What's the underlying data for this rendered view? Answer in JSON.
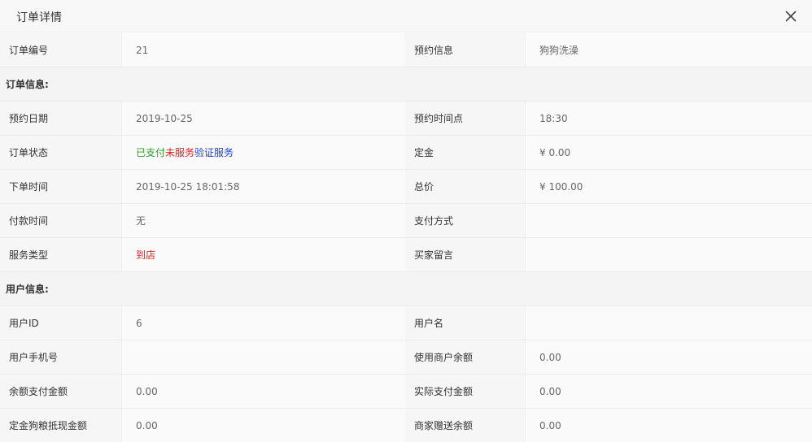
{
  "dialog": {
    "title": "订单详情"
  },
  "top_row": {
    "order_no_label": "订单编号",
    "order_no_value": "21",
    "booking_info_label": "预约信息",
    "booking_info_value": "狗狗洗澡"
  },
  "order_section": {
    "heading": "订单信息:",
    "booking_date_label": "预约日期",
    "booking_date_value": "2019-10-25",
    "booking_time_label": "预约时间点",
    "booking_time_value": "18:30",
    "status_label": "订单状态",
    "status_paid": "已支付",
    "status_unserved": "未服务",
    "status_verify": "验证服务",
    "deposit_label": "定金",
    "deposit_value": "¥ 0.00",
    "order_time_label": "下单时间",
    "order_time_value": "2019-10-25 18:01:58",
    "total_label": "总价",
    "total_value": "¥ 100.00",
    "pay_time_label": "付款时间",
    "pay_time_value": "无",
    "pay_method_label": "支付方式",
    "pay_method_value": "",
    "service_type_label": "服务类型",
    "service_type_value": "到店",
    "buyer_note_label": "买家留言",
    "buyer_note_value": ""
  },
  "user_section": {
    "heading": "用户信息:",
    "user_id_label": "用户ID",
    "user_id_value": "6",
    "username_label": "用户名",
    "username_value": "",
    "phone_label": "用户手机号",
    "phone_value": "",
    "merchant_balance_label": "使用商户余额",
    "merchant_balance_value": "0.00",
    "balance_pay_label": "余额支付金额",
    "balance_pay_value": "0.00",
    "actual_pay_label": "实际支付金额",
    "actual_pay_value": "0.00",
    "deposit_offset_label": "定金狗粮抵现金额",
    "deposit_offset_value": "0.00",
    "gift_balance_label": "商家赠送余额",
    "gift_balance_value": "0.00"
  },
  "icons": {
    "close": "close-icon"
  },
  "colors": {
    "paid": "#2ca02c",
    "unserved": "#e02020",
    "verify": "#1e3fd6",
    "service_type": "#e02020"
  }
}
